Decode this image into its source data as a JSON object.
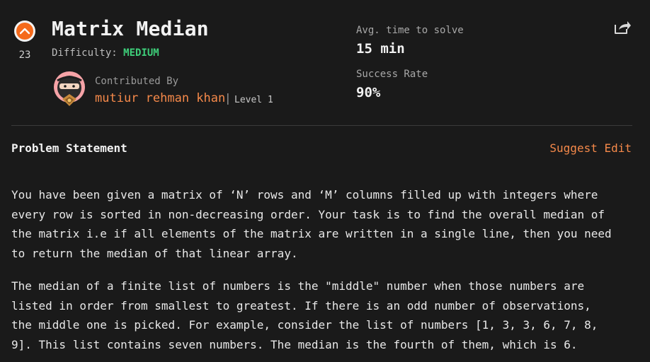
{
  "problem": {
    "title": "Matrix Median",
    "upvotes": "23",
    "difficulty_label": "Difficulty: ",
    "difficulty_level": "MEDIUM"
  },
  "contributor": {
    "label": "Contributed By",
    "name": "mutiur rehman khan",
    "separator": "|",
    "level": "Level 1"
  },
  "stats": {
    "avg_time_label": "Avg. time to solve",
    "avg_time_value": "15 min",
    "success_rate_label": "Success Rate",
    "success_rate_value": "90%"
  },
  "section": {
    "title": "Problem Statement",
    "suggest_edit": "Suggest Edit"
  },
  "statement": {
    "para1": "You have been given a matrix of ‘N’ rows and ‘M’ columns filled up with integers where\nevery row is sorted in non-decreasing order. Your task is to find the overall median of\nthe matrix i.e if all elements of the matrix are written in a single line, then you need\nto return the median of that linear array.",
    "para2": "The median of a finite list of numbers is the \"middle\" number when those numbers are\nlisted in order from smallest to greatest. If there is an odd number of observations,\nthe middle one is picked. For example, consider the list of numbers [1, 3, 3, 6, 7, 8,\n9]. This list contains seven numbers. The median is the fourth of them, which is 6."
  },
  "colors": {
    "background": "#1a1a1a",
    "accent_orange": "#f5894a",
    "upvote_orange": "#f56a1b",
    "difficulty_green": "#3ecf7a"
  },
  "icons": {
    "upvote": "upvote-arrow-icon",
    "share": "share-icon",
    "avatar": "ninja-avatar"
  }
}
